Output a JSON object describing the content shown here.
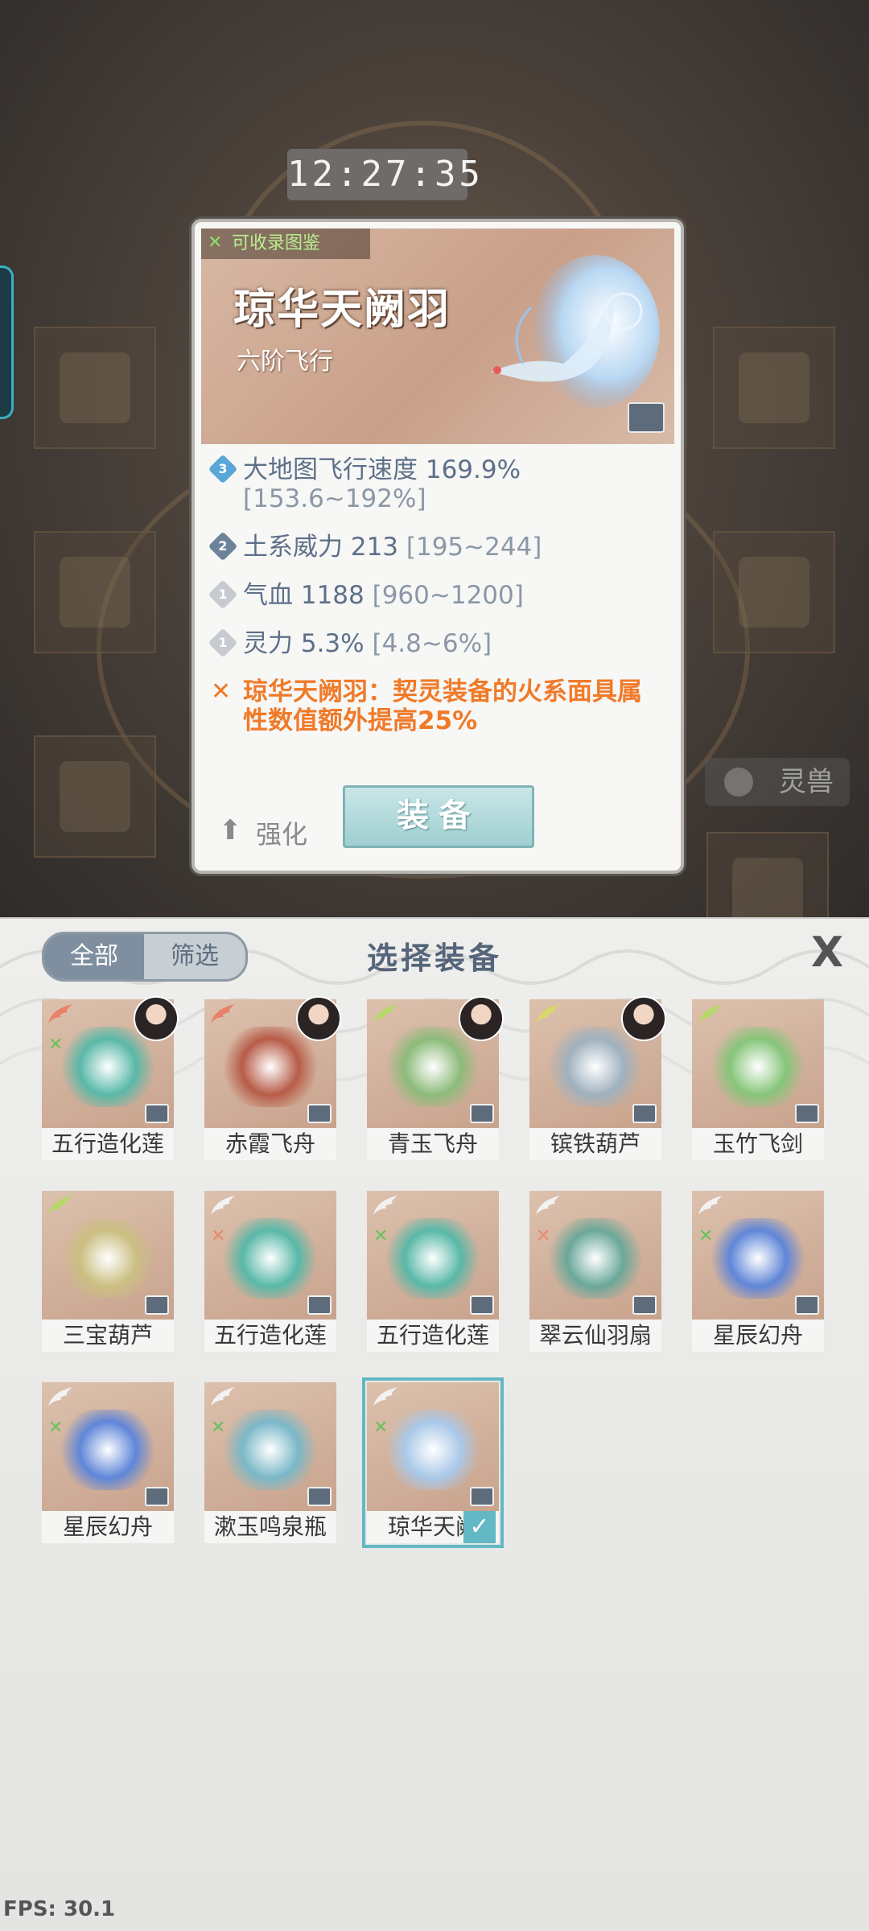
{
  "clock": "12:27:35",
  "background": {
    "side_button_label": "灵兽"
  },
  "popup": {
    "collect_tag": "可收录图鉴",
    "item_name": "琼华天阙羽",
    "item_type": "六阶飞行",
    "stats": [
      {
        "level": "3",
        "text": "大地图飞行速度 169.9%",
        "range": "[153.6~192%]"
      },
      {
        "level": "2",
        "text": "土系威力 213",
        "range": "[195~244]"
      },
      {
        "level": "1",
        "text": "气血 1188",
        "range": "[960~1200]"
      },
      {
        "level": "1",
        "text": "灵力 5.3%",
        "range": "[4.8~6%]"
      }
    ],
    "special_effect": "琼华天阙羽：契灵装备的火系面具属性数值额外提高25%",
    "enhance_label": "强化",
    "equip_label": "装备"
  },
  "panel": {
    "title": "选择装备",
    "tab_all": "全部",
    "tab_filter": "筛选",
    "close_label": "X",
    "items": [
      {
        "name": "五行造化莲",
        "wing": "#e8806a",
        "mark": "✕",
        "mark_color": "#6ac15a",
        "color": "#59b8a8",
        "avatar": true
      },
      {
        "name": "赤霞飞舟",
        "wing": "#e8806a",
        "mark": "",
        "mark_color": "",
        "color": "#b75c48",
        "avatar": true
      },
      {
        "name": "青玉飞舟",
        "wing": "#b6d869",
        "mark": "",
        "mark_color": "",
        "color": "#8dbb7a",
        "avatar": true
      },
      {
        "name": "镔铁葫芦",
        "wing": "#d8d869",
        "mark": "",
        "mark_color": "",
        "color": "#9fb1bf",
        "avatar": true
      },
      {
        "name": "玉竹飞剑",
        "wing": "#b6d869",
        "mark": "",
        "mark_color": "",
        "color": "#86c57a",
        "avatar": false
      },
      {
        "name": "三宝葫芦",
        "wing": "#b6d869",
        "mark": "",
        "mark_color": "",
        "color": "#cbbf82",
        "avatar": false
      },
      {
        "name": "五行造化莲",
        "wing": "#f2f2f2",
        "mark": "✕",
        "mark_color": "#e88a6a",
        "color": "#59b8a8",
        "avatar": false
      },
      {
        "name": "五行造化莲",
        "wing": "#f2f2f2",
        "mark": "✕",
        "mark_color": "#6ac15a",
        "color": "#59b8a8",
        "avatar": false
      },
      {
        "name": "翠云仙羽扇",
        "wing": "#f2f2f2",
        "mark": "✕",
        "mark_color": "#e88a6a",
        "color": "#6aa89a",
        "avatar": false
      },
      {
        "name": "星辰幻舟",
        "wing": "#f2f2f2",
        "mark": "✕",
        "mark_color": "#6ac15a",
        "color": "#5f86d8",
        "avatar": false
      },
      {
        "name": "星辰幻舟",
        "wing": "#f2f2f2",
        "mark": "✕",
        "mark_color": "#6ac15a",
        "color": "#5f86d8",
        "avatar": false
      },
      {
        "name": "漱玉鸣泉瓶",
        "wing": "#f2f2f2",
        "mark": "✕",
        "mark_color": "#6ac15a",
        "color": "#7ab8c8",
        "avatar": false
      },
      {
        "name": "琼华天阙",
        "wing": "#f2f2f2",
        "mark": "✕",
        "mark_color": "#6ac15a",
        "color": "#a9c8e8",
        "avatar": false,
        "selected": true
      }
    ]
  },
  "fps": "FPS: 30.1",
  "colors": {
    "stat_blue": "#5e7089",
    "special_orange": "#f07a28",
    "selected_teal": "#62b8c4"
  }
}
